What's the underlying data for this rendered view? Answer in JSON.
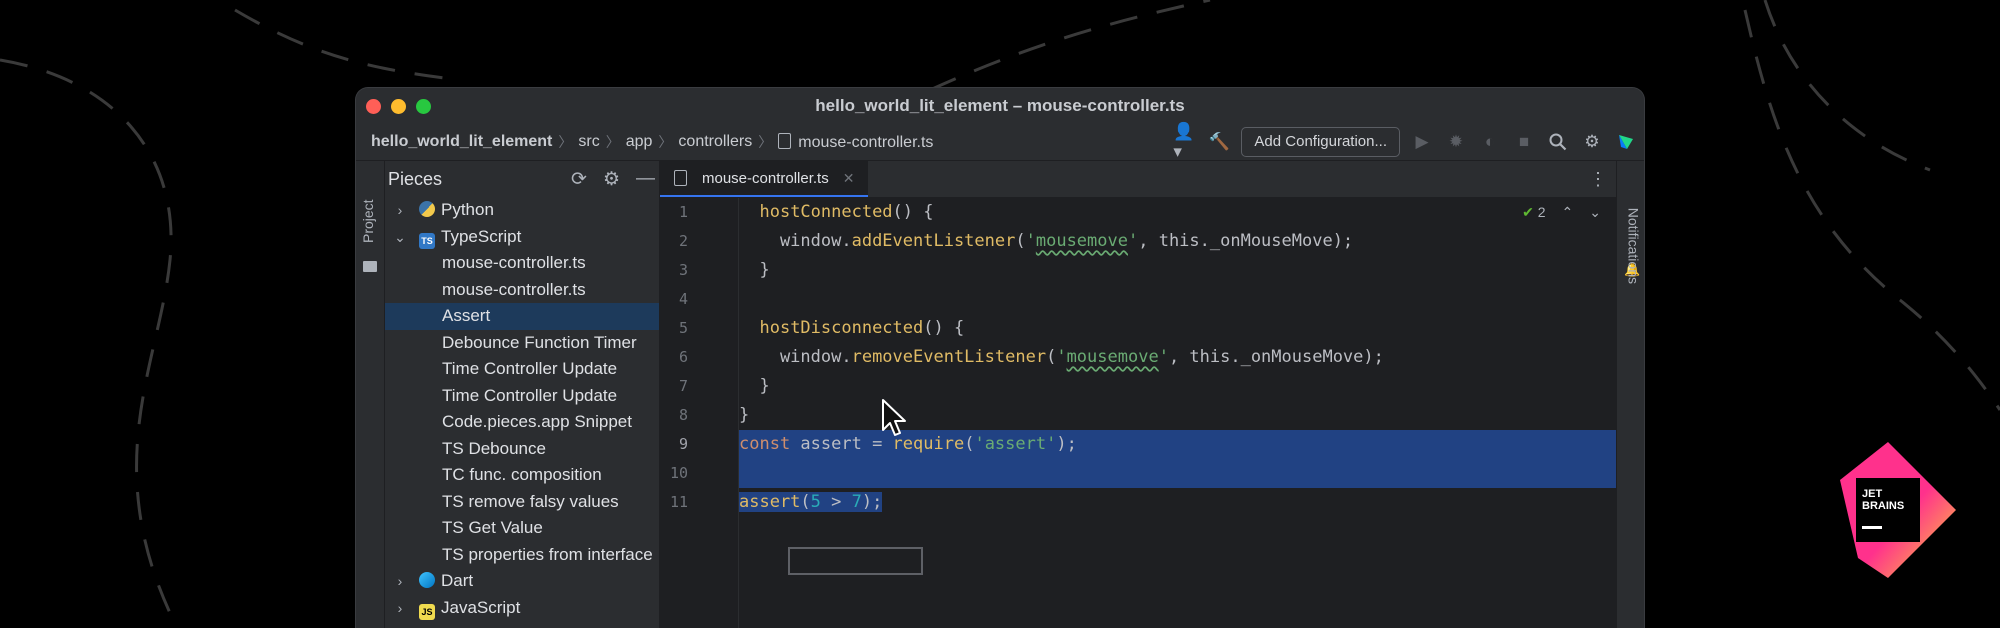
{
  "window": {
    "title": "hello_world_lit_element – mouse-controller.ts"
  },
  "breadcrumb": [
    "hello_world_lit_element",
    "src",
    "app",
    "controllers",
    "mouse-controller.ts"
  ],
  "toolbar": {
    "add_configuration": "Add Configuration..."
  },
  "left_strip": {
    "project_label": "Project"
  },
  "pieces_panel": {
    "title": "Pieces",
    "groups": [
      {
        "label": "Python",
        "expanded": false
      },
      {
        "label": "TypeScript",
        "expanded": true,
        "items": [
          "mouse-controller.ts",
          "mouse-controller.ts",
          "Assert",
          "Debounce Function Timer",
          "Time Controller Update",
          "Time Controller Update",
          "Code.pieces.app Snippet",
          "TS Debounce",
          "TC func. composition",
          "TS remove falsy values",
          "TS Get Value",
          "TS properties from interface"
        ],
        "selected_index": 2
      },
      {
        "label": "Dart",
        "expanded": false
      },
      {
        "label": "JavaScript",
        "expanded": false
      }
    ]
  },
  "editor": {
    "tab": "mouse-controller.ts",
    "inspection_count": "2",
    "line_numbers": [
      "1",
      "2",
      "3",
      "4",
      "5",
      "6",
      "7",
      "8",
      "9",
      "10",
      "11"
    ],
    "current_line": 9
  },
  "right_strip": {
    "notifications_label": "Notifications"
  },
  "brand": {
    "line1": "JET",
    "line2": "BRAINS"
  },
  "colors": {
    "selection": "#214283",
    "accent": "#3574f0",
    "tree_selection": "#1d3a5b"
  }
}
